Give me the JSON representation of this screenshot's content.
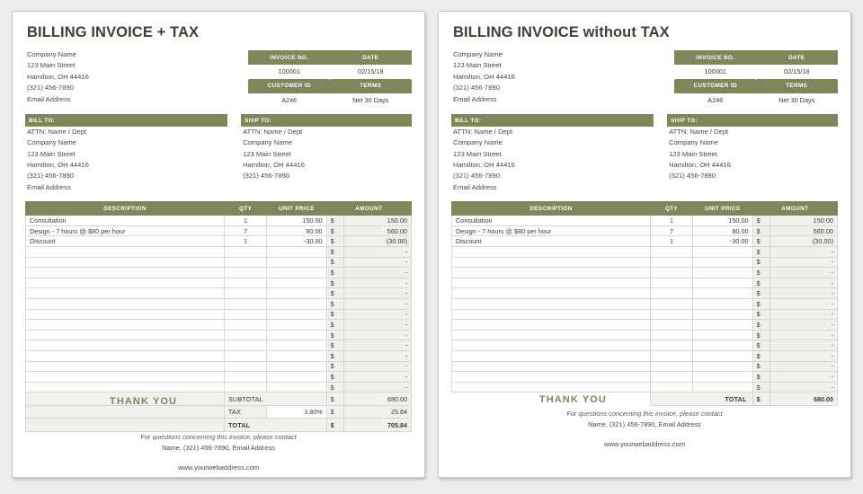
{
  "workspace": {
    "background_color": "#ededed",
    "accent_color": "#80855a",
    "card_background": "#ffffff",
    "amount_cell_background": "#f0f0ec"
  },
  "invoice_tax": {
    "title_main": "BILLING INVOICE",
    "title_suffix": "+ TAX",
    "title_full": "BILLING INVOICE + TAX",
    "company": {
      "lines": [
        "Company Name",
        "123 Main Street",
        "Hamilton, OH  44416",
        "(321) 456-7890",
        "Email Address"
      ]
    },
    "meta": {
      "header_invoice_no": "INVOICE NO.",
      "header_date": "DATE",
      "value_invoice_no": "100001",
      "value_date": "02/15/18",
      "header_customer_id": "CUSTOMER ID",
      "header_terms": "TERMS",
      "value_customer_id": "A246",
      "value_terms": "Net 30 Days"
    },
    "bill_to": {
      "header": "BILL TO:",
      "lines": [
        "ATTN: Name / Dept",
        "Company Name",
        "123 Main Street",
        "Hamilton, OH  44416",
        "(321) 456-7890",
        "Email Address"
      ]
    },
    "ship_to": {
      "header": "SHIP TO:",
      "lines": [
        "ATTN: Name / Dept",
        "Company Name",
        "123 Main Street",
        "Hamilton, OH  44416",
        "(321) 456-7890"
      ]
    },
    "items_table": {
      "headers": {
        "description": "DESCRIPTION",
        "qty": "QTY",
        "unit_price": "UNIT PRICE",
        "amount": "AMOUNT"
      },
      "rows": [
        {
          "description": "Consultation",
          "qty": "1",
          "unit_price": "150.00",
          "currency": "$",
          "amount": "150.00"
        },
        {
          "description": "Design - 7 hours @ $80 per hour",
          "qty": "7",
          "unit_price": "80.00",
          "currency": "$",
          "amount": "560.00"
        },
        {
          "description": "Discount",
          "qty": "1",
          "unit_price": "-30.00",
          "currency": "$",
          "amount": "(30.00)"
        }
      ],
      "empty_row_count": 14,
      "empty_row_currency": "$",
      "empty_row_amount": "-"
    },
    "totals": {
      "subtotal_label": "SUBTOTAL",
      "subtotal_currency": "$",
      "subtotal_value": "680.00",
      "tax_label": "TAX",
      "tax_rate": "3.80%",
      "tax_currency": "$",
      "tax_value": "25.84",
      "total_label": "TOTAL",
      "total_currency": "$",
      "total_value": "705.84"
    },
    "thank_you": "THANK YOU",
    "footer": {
      "contact_line_italic": "For questions concerning this invoice, please contact",
      "contact_line_name": "Name, (321) 456-7890, Email Address",
      "web_address": "www.yourwebaddress.com"
    }
  },
  "invoice_no_tax": {
    "title_main": "BILLING INVOICE",
    "title_suffix": "without TAX",
    "title_full": "BILLING INVOICE without TAX",
    "company": {
      "lines": [
        "Company Name",
        "123 Main Street",
        "Hamilton, OH  44416",
        "(321) 456-7890",
        "Email Address"
      ]
    },
    "meta": {
      "header_invoice_no": "INVOICE NO.",
      "header_date": "DATE",
      "value_invoice_no": "100001",
      "value_date": "02/15/18",
      "header_customer_id": "CUSTOMER ID",
      "header_terms": "TERMS",
      "value_customer_id": "A246",
      "value_terms": "Net 30 Days"
    },
    "bill_to": {
      "header": "BILL TO:",
      "lines": [
        "ATTN: Name / Dept",
        "Company Name",
        "123 Main Street",
        "Hamilton, OH  44416",
        "(321) 456-7890",
        "Email Address"
      ]
    },
    "ship_to": {
      "header": "SHIP TO:",
      "lines": [
        "ATTN: Name / Dept",
        "Company Name",
        "123 Main Street",
        "Hamilton, OH  44416",
        "(321) 456-7890"
      ]
    },
    "items_table": {
      "headers": {
        "description": "DESCRIPTION",
        "qty": "QTY",
        "unit_price": "UNIT PRICE",
        "amount": "AMOUNT"
      },
      "rows": [
        {
          "description": "Consultation",
          "qty": "1",
          "unit_price": "150.00",
          "currency": "$",
          "amount": "150.00"
        },
        {
          "description": "Design - 7 hours @ $80 per hour",
          "qty": "7",
          "unit_price": "80.00",
          "currency": "$",
          "amount": "560.00"
        },
        {
          "description": "Discount",
          "qty": "1",
          "unit_price": "-30.00",
          "currency": "$",
          "amount": "(30.00)"
        }
      ],
      "empty_row_count": 14,
      "empty_row_currency": "$",
      "empty_row_amount": "-"
    },
    "totals": {
      "total_label": "TOTAL",
      "total_currency": "$",
      "total_value": "680.00"
    },
    "thank_you": "THANK YOU",
    "footer": {
      "contact_line_italic": "For questions concerning this invoice, please contact",
      "contact_line_name": "Name, (321) 456-7890, Email Address",
      "web_address": "www.yourwebaddress.com"
    }
  }
}
